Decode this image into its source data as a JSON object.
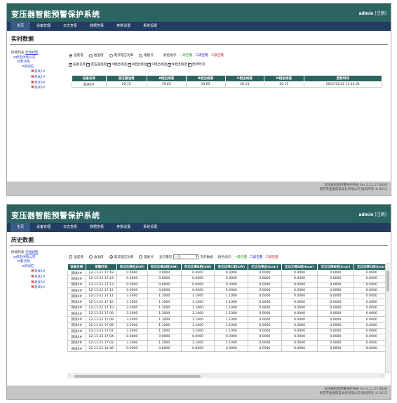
{
  "app": {
    "title": "变压器智能预警保护系统",
    "user": "admin",
    "logout": "[注销]"
  },
  "nav": [
    "主页",
    "设备管理",
    "日志查看",
    "数据查看",
    "参数设置",
    "系统设置"
  ],
  "tree": {
    "label": "终端列表:",
    "link": "手动刷新",
    "root": "保定供电公司",
    "node1": "鲁湾线",
    "node2": "测试匹",
    "leaves": [
      "测试1#",
      "测试2#",
      "测试3#",
      "测试4#"
    ]
  },
  "footer": {
    "line1": "双压器智能预警保护系统 Ver 2.11.27.0826",
    "line2": "保定市金凰晟自动化有限公司 版权所有 © 2012"
  },
  "realtime": {
    "section_title": "实时数据",
    "radios": [
      "温度值",
      "油温值",
      "电流电压功率",
      "电能点"
    ],
    "selected_radio": "温度值",
    "legend_label": "颜色指示:",
    "legend": [
      "一级告警",
      "二级告警",
      "三级告警"
    ],
    "checkboxes": [
      "设备名称",
      "变压器温度",
      "A相出线温",
      "B相出线温",
      "C相出线温",
      "N相出线温",
      "更新时间"
    ],
    "columns": [
      "设备名称",
      "变压器油温",
      "A相出线温",
      "B相出线温",
      "C相出线温",
      "N相出线温",
      "更新时间"
    ],
    "rows": [
      [
        "测试4#",
        "20.15",
        "19.65",
        "19.65",
        "20.15",
        "20.15",
        "2012/11/12 11:14:31"
      ]
    ]
  },
  "history": {
    "section_title": "历史数据",
    "radios": [
      "温度值",
      "油温值",
      "电流电压功率",
      "电能点"
    ],
    "selected_radio": "电流电压功率",
    "show_label": "显示最近",
    "show_value": "一天",
    "show_suffix": "天的数据",
    "legend_label": "颜色指示:",
    "legend": [
      "一级告警",
      "二级告警",
      "三级告警"
    ],
    "columns": [
      "设备名称",
      "采集时间",
      "有功功率总(kW)",
      "有功功率A相(kW)",
      "有功功率B相(kW)",
      "有功功率C相(kW)",
      "无功功率总(kvar)",
      "无功功率A相(kvar)",
      "无功功率B相(kvar)",
      "无功功率C相(kvar)"
    ],
    "rows": [
      [
        "测试4#",
        "12-11-22 17:18",
        "0.0000",
        "0.0000",
        "0.0000",
        "0.0000",
        "0.0000",
        "0.0000",
        "0.0000",
        "0.0000"
      ],
      [
        "测试4#",
        "12-11-22 17:13",
        "0.0000",
        "0.0000",
        "0.0000",
        "0.0000",
        "0.0000",
        "0.0000",
        "0.0000",
        "0.0000"
      ],
      [
        "测试4#",
        "12-11-22 17:13",
        "0.0000",
        "0.0000",
        "0.0000",
        "0.0000",
        "0.0000",
        "0.0000",
        "0.0000",
        "0.0000"
      ],
      [
        "测试4#",
        "12-11-22 17:12",
        "0.0000",
        "0.0000",
        "0.0000",
        "0.0000",
        "0.0000",
        "0.0000",
        "0.0000",
        "0.0000"
      ],
      [
        "测试4#",
        "12-11-22 17:11",
        "3.3000",
        "1.1000",
        "1.1000",
        "1.1000",
        "0.0000",
        "0.0000",
        "0.0000",
        "0.0000"
      ],
      [
        "测试4#",
        "12-11-22 17:10",
        "3.3000",
        "1.1000",
        "1.1000",
        "1.1000",
        "0.0000",
        "0.0000",
        "0.0000",
        "0.0000"
      ],
      [
        "测试4#",
        "12-11-22 17:10",
        "3.3000",
        "1.1000",
        "1.1000",
        "1.1000",
        "0.0000",
        "0.0000",
        "0.0000",
        "0.0000"
      ],
      [
        "测试4#",
        "12-11-22 17:09",
        "3.3000",
        "1.1000",
        "1.1000",
        "1.1000",
        "0.0000",
        "0.0000",
        "0.0000",
        "0.0000"
      ],
      [
        "测试4#",
        "12-11-22 17:08",
        "3.3000",
        "1.1000",
        "1.1000",
        "1.1000",
        "0.0000",
        "0.0000",
        "0.0000",
        "0.0000"
      ],
      [
        "测试4#",
        "12-11-22 17:08",
        "3.3000",
        "1.1000",
        "1.1000",
        "1.1000",
        "0.0000",
        "0.0000",
        "0.0000",
        "0.0000"
      ],
      [
        "测试4#",
        "12-11-22 17:07",
        "3.3000",
        "1.1000",
        "1.1000",
        "1.1000",
        "0.0000",
        "0.0000",
        "0.0000",
        "0.0000"
      ],
      [
        "测试4#",
        "12-11-22 17:04",
        "0.0000",
        "0.0000",
        "0.0000",
        "0.0000",
        "0.0000",
        "0.0000",
        "0.0000",
        "0.0000"
      ],
      [
        "测试4#",
        "12-11-22 17:02",
        "3.3000",
        "1.1000",
        "1.1000",
        "1.1000",
        "0.0000",
        "0.0000",
        "0.0000",
        "0.0000"
      ],
      [
        "测试4#",
        "12-11-22 16:46",
        "0.0000",
        "0.0000",
        "0.0000",
        "0.0000",
        "0.0000",
        "0.0000",
        "0.0000",
        "0.0000"
      ]
    ]
  }
}
